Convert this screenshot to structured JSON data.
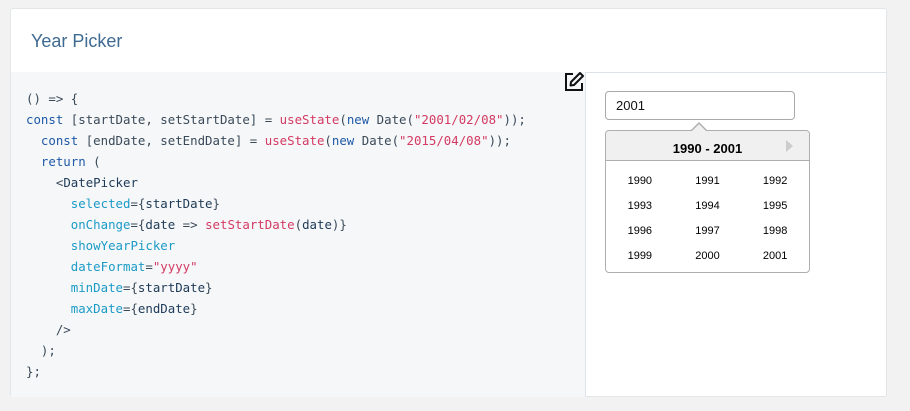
{
  "card": {
    "title": "Year Picker"
  },
  "code": {
    "lines": [
      [
        {
          "c": "t",
          "v": "() => {"
        }
      ],
      [
        {
          "c": "kw",
          "v": "const"
        },
        {
          "c": "t",
          "v": " [startDate, setStartDate] = "
        },
        {
          "c": "fn",
          "v": "useState"
        },
        {
          "c": "t",
          "v": "("
        },
        {
          "c": "kw",
          "v": "new"
        },
        {
          "c": "t",
          "v": " Date("
        },
        {
          "c": "str",
          "v": "\"2001/02/08\""
        },
        {
          "c": "t",
          "v": "));"
        }
      ],
      [
        {
          "c": "t",
          "v": "  "
        },
        {
          "c": "kw",
          "v": "const"
        },
        {
          "c": "t",
          "v": " [endDate, setEndDate] = "
        },
        {
          "c": "fn",
          "v": "useState"
        },
        {
          "c": "t",
          "v": "("
        },
        {
          "c": "kw",
          "v": "new"
        },
        {
          "c": "t",
          "v": " Date("
        },
        {
          "c": "str",
          "v": "\"2015/04/08\""
        },
        {
          "c": "t",
          "v": "));"
        }
      ],
      [
        {
          "c": "t",
          "v": "  "
        },
        {
          "c": "kw",
          "v": "return"
        },
        {
          "c": "t",
          "v": " ("
        }
      ],
      [
        {
          "c": "t",
          "v": "    <"
        },
        {
          "c": "id",
          "v": "DatePicker"
        }
      ],
      [
        {
          "c": "t",
          "v": "      "
        },
        {
          "c": "at",
          "v": "selected"
        },
        {
          "c": "t",
          "v": "={"
        },
        {
          "c": "id",
          "v": "startDate"
        },
        {
          "c": "t",
          "v": "}"
        }
      ],
      [
        {
          "c": "t",
          "v": "      "
        },
        {
          "c": "at",
          "v": "onChange"
        },
        {
          "c": "t",
          "v": "={"
        },
        {
          "c": "id",
          "v": "date"
        },
        {
          "c": "t",
          "v": " => "
        },
        {
          "c": "fn",
          "v": "setStartDate"
        },
        {
          "c": "t",
          "v": "("
        },
        {
          "c": "id",
          "v": "date"
        },
        {
          "c": "t",
          "v": ")}"
        }
      ],
      [
        {
          "c": "t",
          "v": "      "
        },
        {
          "c": "at",
          "v": "showYearPicker"
        }
      ],
      [
        {
          "c": "t",
          "v": "      "
        },
        {
          "c": "at",
          "v": "dateFormat"
        },
        {
          "c": "t",
          "v": "="
        },
        {
          "c": "str",
          "v": "\"yyyy\""
        }
      ],
      [
        {
          "c": "t",
          "v": "      "
        },
        {
          "c": "at",
          "v": "minDate"
        },
        {
          "c": "t",
          "v": "={"
        },
        {
          "c": "id",
          "v": "startDate"
        },
        {
          "c": "t",
          "v": "}"
        }
      ],
      [
        {
          "c": "t",
          "v": "      "
        },
        {
          "c": "at",
          "v": "maxDate"
        },
        {
          "c": "t",
          "v": "={"
        },
        {
          "c": "id",
          "v": "endDate"
        },
        {
          "c": "t",
          "v": "}"
        }
      ],
      [
        {
          "c": "t",
          "v": "    />"
        }
      ],
      [
        {
          "c": "t",
          "v": "  );"
        }
      ],
      [
        {
          "c": "t",
          "v": "};"
        }
      ]
    ]
  },
  "edit_icon": "edit-icon",
  "picker": {
    "input_value": "2001",
    "range_label": "1990 - 2001",
    "next_icon": "triangle-right-icon",
    "years": [
      "1990",
      "1991",
      "1992",
      "1993",
      "1994",
      "1995",
      "1996",
      "1997",
      "1998",
      "1999",
      "2000",
      "2001"
    ]
  },
  "colors": {
    "title": "#3f6a91",
    "string": "#d43a62",
    "keyword": "#1f59a6",
    "attribute": "#1c9bc6",
    "code_bg": "#f5f7f9"
  }
}
